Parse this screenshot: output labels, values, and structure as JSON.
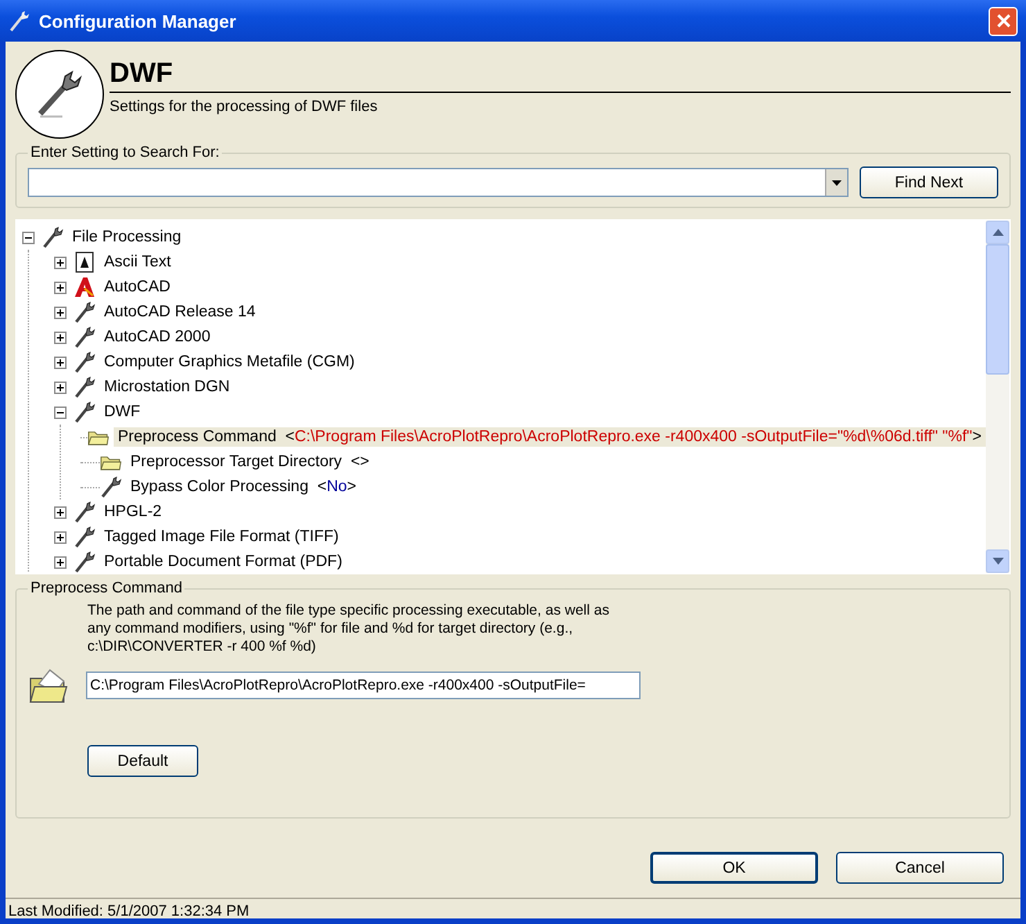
{
  "window": {
    "title": "Configuration Manager"
  },
  "header": {
    "title": "DWF",
    "subtitle": "Settings for the processing of DWF files"
  },
  "search": {
    "label": "Enter Setting to Search For:",
    "button": "Find Next"
  },
  "tree": [
    {
      "label": "File Processing",
      "kind": "wrench",
      "expanded": true,
      "selected": false,
      "children": [
        {
          "label": "Ascii Text",
          "kind": "text",
          "expanded": false,
          "selected": false
        },
        {
          "label": "AutoCAD",
          "kind": "autocad",
          "expanded": false,
          "selected": false
        },
        {
          "label": "AutoCAD Release 14",
          "kind": "wrench",
          "expanded": false,
          "selected": false
        },
        {
          "label": "AutoCAD 2000",
          "kind": "wrench",
          "expanded": false,
          "selected": false
        },
        {
          "label": "Computer Graphics Metafile (CGM)",
          "kind": "wrench",
          "expanded": false,
          "selected": false
        },
        {
          "label": "Microstation DGN",
          "kind": "wrench",
          "expanded": false,
          "selected": false
        },
        {
          "label": "DWF",
          "kind": "wrench",
          "expanded": true,
          "selected": false,
          "children": [
            {
              "label": "Preprocess Command",
              "kind": "folder",
              "selected": true,
              "value": "<C:\\Program Files\\AcroPlotRepro\\AcroPlotRepro.exe -r400x400 -sOutputFile=\"%d\\%06d.tiff\" \"%f\">",
              "color": "#cc0000"
            },
            {
              "label": "Preprocessor Target Directory",
              "kind": "folder",
              "selected": false,
              "value": "<>",
              "color": "#000000"
            },
            {
              "label": "Bypass Color Processing",
              "kind": "wrench",
              "selected": false,
              "value": "<No>",
              "color": "#000099"
            }
          ]
        },
        {
          "label": "HPGL-2",
          "kind": "wrench",
          "expanded": false,
          "selected": false
        },
        {
          "label": "Tagged Image File Format (TIFF)",
          "kind": "wrench",
          "expanded": false,
          "selected": false
        },
        {
          "label": "Portable Document Format (PDF)",
          "kind": "wrench",
          "expanded": false,
          "selected": false
        }
      ]
    }
  ],
  "details": {
    "label": "Preprocess Command",
    "description": "The path and command of the file type specific processing executable, as well as any command modifiers, using \"%f\" for file and %d for target directory (e.g., c:\\DIR\\CONVERTER -r 400 %f %d)",
    "value": "C:\\Program Files\\AcroPlotRepro\\AcroPlotRepro.exe -r400x400 -sOutputFile=",
    "button": "Default"
  },
  "buttons": [
    "OK",
    "Cancel"
  ],
  "status_bar": "Last Modified: 5/1/2007 1:32:34 PM"
}
